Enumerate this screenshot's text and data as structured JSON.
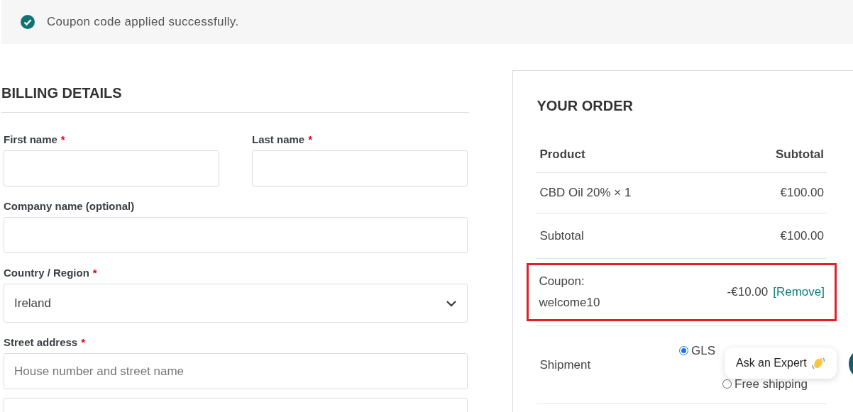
{
  "notice": {
    "kind": "success",
    "text": "Coupon code applied successfully."
  },
  "billing": {
    "title": "BILLING DETAILS",
    "fields": [
      [
        {
          "label": "First name",
          "required_mark": "*",
          "kind": "input"
        },
        {
          "label": "Last name",
          "required_mark": "*",
          "kind": "input"
        }
      ],
      [
        {
          "label": "Company name (optional)",
          "kind": "input"
        }
      ],
      [
        {
          "label": "Country / Region",
          "required_mark": "*",
          "kind": "select",
          "value": "Ireland"
        }
      ],
      [
        {
          "label": "Street address",
          "required_mark": "*",
          "kind": "input",
          "placeholder": "House number and street name",
          "extra_line": true
        }
      ]
    ]
  },
  "order": {
    "title": "YOUR ORDER",
    "columns": [
      "Product",
      "Subtotal"
    ],
    "rows": [
      {
        "kind": "item",
        "label": "CBD Oil 20% × 1",
        "value": "€100.00"
      },
      {
        "kind": "subtotal",
        "label": "Subtotal",
        "value": "€100.00"
      },
      {
        "kind": "coupon",
        "label": "Coupon:",
        "code": "welcome10",
        "value": "-€10.00",
        "link": "[Remove]",
        "highlighted": true
      },
      {
        "kind": "shipping",
        "label": "Shipment",
        "options": [
          {
            "label": "GLS",
            "selected": true
          },
          {
            "label": "Free shipping",
            "selected": false
          }
        ]
      }
    ]
  },
  "chat": {
    "bubble": "Ask an Expert"
  }
}
